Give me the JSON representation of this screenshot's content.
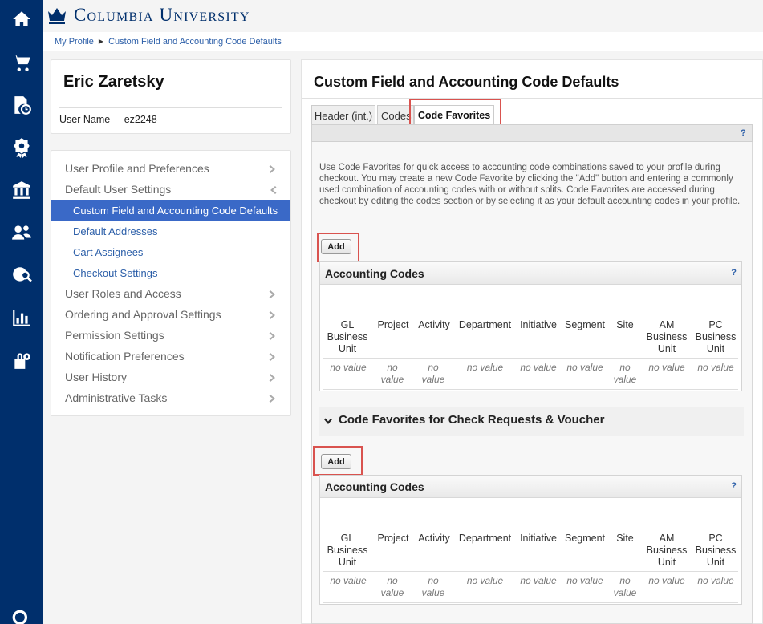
{
  "header": {
    "logo_text": "Columbia University"
  },
  "breadcrumb": {
    "items": [
      "My Profile",
      "Custom Field and Accounting Code Defaults"
    ]
  },
  "profile": {
    "name": "Eric Zaretsky",
    "user_label": "User Name",
    "user_value": "ez2248"
  },
  "nav": {
    "items": [
      "User Profile and Preferences",
      "Default User Settings",
      "Custom Field and Accounting Code Defaults",
      "Default Addresses",
      "Cart Assignees",
      "Checkout Settings",
      "User Roles and Access",
      "Ordering and Approval Settings",
      "Permission Settings",
      "Notification Preferences",
      "User History",
      "Administrative Tasks"
    ]
  },
  "main": {
    "title": "Custom Field and Accounting Code Defaults",
    "tabs": [
      "Header (int.)",
      "Codes",
      "Code Favorites"
    ],
    "help": "?",
    "intro": "Use Code Favorites for quick access to accounting code combinations saved to your profile during checkout. You may create a new Code Favorite by clicking the \"Add\" button and entering a commonly used combination of accounting codes with or without splits. Code Favorites are accessed during checkout by editing the codes section or by selecting it as your default accounting codes in your profile.",
    "add_label": "Add",
    "accounting_title": "Accounting Codes",
    "section2_title": "Code Favorites for Check Requests & Voucher",
    "columns": [
      "GL Business Unit",
      "Project",
      "Activity",
      "Department",
      "Initiative",
      "Segment",
      "Site",
      "AM Business Unit",
      "PC Business Unit"
    ],
    "empty_value": "no value"
  },
  "colors": {
    "rail": "#002f6c",
    "active": "#3a69c7",
    "highlight": "#d9534f",
    "link": "#2b5ea8"
  },
  "icons": [
    "home-icon",
    "cart-icon",
    "clock-document-icon",
    "badge-icon",
    "bank-icon",
    "users-icon",
    "globe-search-icon",
    "bar-chart-icon",
    "lock-gear-icon",
    "search-icon"
  ]
}
